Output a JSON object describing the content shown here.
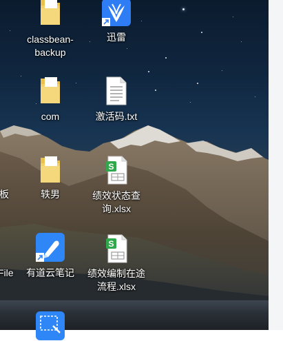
{
  "desktop": {
    "icons": [
      {
        "label_lines": [
          "classbean-",
          "backup"
        ],
        "icon": "folder-icon"
      },
      {
        "label_lines": [
          "迅雷"
        ],
        "icon": "thunder-download-icon"
      },
      {
        "label_lines": [
          "com"
        ],
        "icon": "folder-icon"
      },
      {
        "label_lines": [
          "激活码.txt"
        ],
        "icon": "text-file-icon"
      },
      {
        "label_lines": [
          "轶男"
        ],
        "icon": "folder-icon"
      },
      {
        "label_lines": [
          "绩效状态查",
          "询.xlsx"
        ],
        "icon": "spreadsheet-file-icon"
      },
      {
        "label_lines": [
          "有道云笔记"
        ],
        "icon": "youdao-note-icon"
      },
      {
        "label_lines": [
          "绩效编制在途",
          "流程.xlsx"
        ],
        "icon": "spreadsheet-file-icon"
      },
      {
        "label_lines": [],
        "icon": "screenshot-tool-icon"
      }
    ],
    "edge_labels": [
      "板",
      "File"
    ],
    "colors": {
      "folder": "#f3cf6a",
      "thunder": "#2f7df4",
      "spreadsheet": "#2ea84a",
      "youdao": "#2f86f6"
    }
  }
}
